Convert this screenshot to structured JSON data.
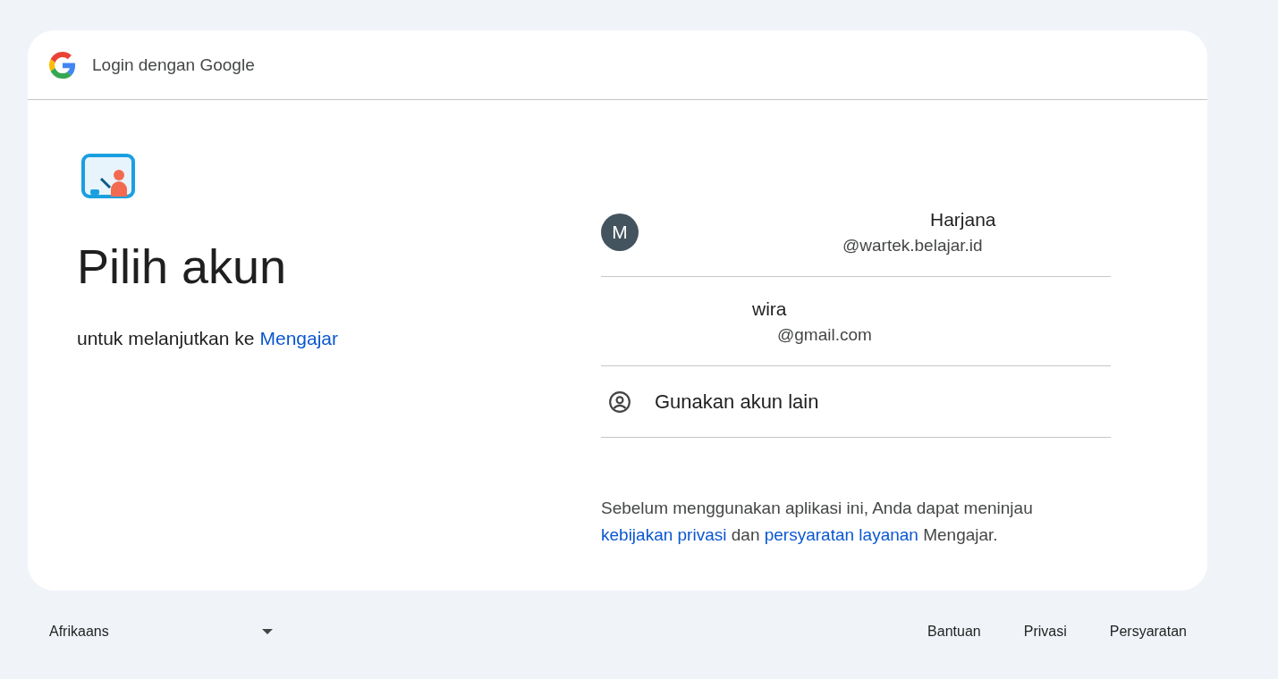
{
  "header": {
    "title": "Login dengan Google"
  },
  "heading": "Pilih akun",
  "subtitle": {
    "text": "untuk melanjutkan ke",
    "app_link": "Mengajar"
  },
  "accounts": [
    {
      "kind": "account",
      "avatar_letter": "M",
      "name": "Harjana",
      "email": "@wartek.belajar.id"
    },
    {
      "kind": "account",
      "name": "wira",
      "email": "@gmail.com"
    },
    {
      "kind": "other",
      "label": "Gunakan akun lain"
    }
  ],
  "consent": [
    {
      "kind": "text",
      "text": "Sebelum menggunakan aplikasi ini, Anda dapat meninjau"
    },
    {
      "kind": "link",
      "text": "kebijakan privasi"
    },
    {
      "kind": "text",
      "text": "dan"
    },
    {
      "kind": "link",
      "text": "persyaratan layanan"
    },
    {
      "kind": "text",
      "text": "Mengajar."
    }
  ],
  "footer": {
    "language": "Afrikaans",
    "links": [
      "Bantuan",
      "Privasi",
      "Persyaratan"
    ]
  }
}
